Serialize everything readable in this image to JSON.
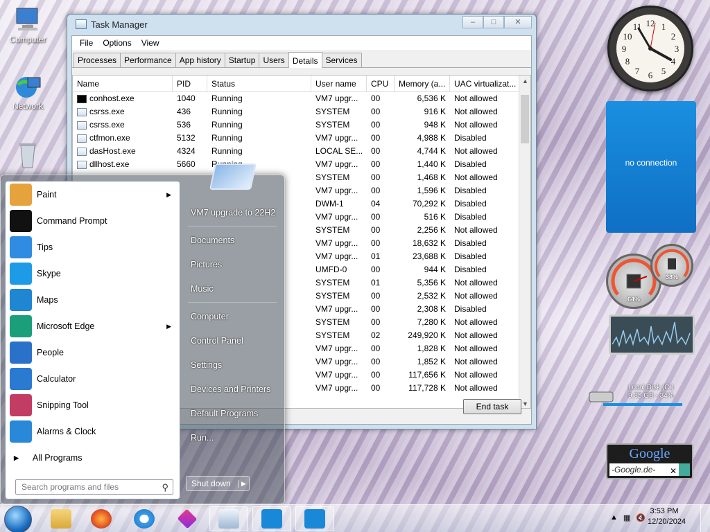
{
  "desktop": {
    "icons": [
      {
        "label": "Computer"
      },
      {
        "label": "Network"
      },
      {
        "label": ""
      }
    ]
  },
  "taskmgr": {
    "title": "Task Manager",
    "menu": [
      "File",
      "Options",
      "View"
    ],
    "tabs": [
      "Processes",
      "Performance",
      "App history",
      "Startup",
      "Users",
      "Details",
      "Services"
    ],
    "active_tab": "Details",
    "columns": [
      "Name",
      "PID",
      "Status",
      "User name",
      "CPU",
      "Memory (a...",
      "UAC virtualizat..."
    ],
    "rows": [
      {
        "name": "conhost.exe",
        "pid": "1040",
        "status": "Running",
        "user": "VM7 upgr...",
        "cpu": "00",
        "mem": "6,536 K",
        "uac": "Not allowed",
        "icon": "cmd"
      },
      {
        "name": "csrss.exe",
        "pid": "436",
        "status": "Running",
        "user": "SYSTEM",
        "cpu": "00",
        "mem": "916 K",
        "uac": "Not allowed",
        "icon": "app"
      },
      {
        "name": "csrss.exe",
        "pid": "536",
        "status": "Running",
        "user": "SYSTEM",
        "cpu": "00",
        "mem": "948 K",
        "uac": "Not allowed",
        "icon": "app"
      },
      {
        "name": "ctfmon.exe",
        "pid": "5132",
        "status": "Running",
        "user": "VM7 upgr...",
        "cpu": "00",
        "mem": "4,988 K",
        "uac": "Disabled",
        "icon": "app"
      },
      {
        "name": "dasHost.exe",
        "pid": "4324",
        "status": "Running",
        "user": "LOCAL SE...",
        "cpu": "00",
        "mem": "4,744 K",
        "uac": "Not allowed",
        "icon": "app"
      },
      {
        "name": "dllhost.exe",
        "pid": "5660",
        "status": "Running",
        "user": "VM7 upgr...",
        "cpu": "00",
        "mem": "1,440 K",
        "uac": "Disabled",
        "icon": "app"
      },
      {
        "name": "",
        "pid": "",
        "status": "",
        "user": "SYSTEM",
        "cpu": "00",
        "mem": "1,468 K",
        "uac": "Not allowed",
        "icon": ""
      },
      {
        "name": "",
        "pid": "",
        "status": "",
        "user": "VM7 upgr...",
        "cpu": "00",
        "mem": "1,596 K",
        "uac": "Disabled",
        "icon": ""
      },
      {
        "name": "",
        "pid": "",
        "status": "",
        "user": "DWM-1",
        "cpu": "04",
        "mem": "70,292 K",
        "uac": "Disabled",
        "icon": ""
      },
      {
        "name": "",
        "pid": "",
        "status": "",
        "user": "VM7 upgr...",
        "cpu": "00",
        "mem": "516 K",
        "uac": "Disabled",
        "icon": ""
      },
      {
        "name": "",
        "pid": "",
        "status": "",
        "user": "SYSTEM",
        "cpu": "00",
        "mem": "2,256 K",
        "uac": "Not allowed",
        "icon": ""
      },
      {
        "name": "",
        "pid": "",
        "status": "",
        "user": "VM7 upgr...",
        "cpu": "00",
        "mem": "18,632 K",
        "uac": "Disabled",
        "icon": ""
      },
      {
        "name": "",
        "pid": "",
        "status": "",
        "user": "VM7 upgr...",
        "cpu": "01",
        "mem": "23,688 K",
        "uac": "Disabled",
        "icon": ""
      },
      {
        "name": "",
        "pid": "",
        "status": "",
        "user": "UMFD-0",
        "cpu": "00",
        "mem": "944 K",
        "uac": "Disabled",
        "icon": ""
      },
      {
        "name": "",
        "pid": "",
        "status": "",
        "user": "SYSTEM",
        "cpu": "01",
        "mem": "5,356 K",
        "uac": "Not allowed",
        "icon": ""
      },
      {
        "name": "",
        "pid": "",
        "status": "",
        "user": "SYSTEM",
        "cpu": "00",
        "mem": "2,532 K",
        "uac": "Not allowed",
        "icon": ""
      },
      {
        "name": "",
        "pid": "",
        "status": "",
        "user": "VM7 upgr...",
        "cpu": "00",
        "mem": "2,308 K",
        "uac": "Disabled",
        "icon": ""
      },
      {
        "name": "",
        "pid": "",
        "status": "",
        "user": "SYSTEM",
        "cpu": "00",
        "mem": "7,280 K",
        "uac": "Not allowed",
        "icon": ""
      },
      {
        "name": "",
        "pid": "",
        "status": "",
        "user": "SYSTEM",
        "cpu": "02",
        "mem": "249,920 K",
        "uac": "Not allowed",
        "icon": ""
      },
      {
        "name": "",
        "pid": "",
        "status": "",
        "user": "VM7 upgr...",
        "cpu": "00",
        "mem": "1,828 K",
        "uac": "Not allowed",
        "icon": ""
      },
      {
        "name": "",
        "pid": "",
        "status": "",
        "user": "VM7 upgr...",
        "cpu": "00",
        "mem": "1,852 K",
        "uac": "Not allowed",
        "icon": ""
      },
      {
        "name": "",
        "pid": "",
        "status": "",
        "user": "VM7 upgr...",
        "cpu": "00",
        "mem": "117,656 K",
        "uac": "Not allowed",
        "icon": ""
      },
      {
        "name": "",
        "pid": "",
        "status": "",
        "user": "VM7 upgr...",
        "cpu": "00",
        "mem": "117,728 K",
        "uac": "Not allowed",
        "icon": ""
      }
    ],
    "end_task": "End task"
  },
  "start_menu": {
    "programs": [
      {
        "label": "Paint",
        "icon": "paint-icon",
        "color": "#e6a23c",
        "submenu": true
      },
      {
        "label": "Command Prompt",
        "icon": "command-prompt-icon",
        "color": "#111111",
        "submenu": false
      },
      {
        "label": "Tips",
        "icon": "tips-icon",
        "color": "#2f8ce0",
        "submenu": false
      },
      {
        "label": "Skype",
        "icon": "skype-icon",
        "color": "#1d9be6",
        "submenu": false
      },
      {
        "label": "Maps",
        "icon": "maps-icon",
        "color": "#1f86d1",
        "submenu": false
      },
      {
        "label": "Microsoft Edge",
        "icon": "edge-icon",
        "color": "#1a9f7a",
        "submenu": true
      },
      {
        "label": "People",
        "icon": "people-icon",
        "color": "#2a72c9",
        "submenu": false
      },
      {
        "label": "Calculator",
        "icon": "calculator-icon",
        "color": "#2a7ad1",
        "submenu": false
      },
      {
        "label": "Snipping Tool",
        "icon": "snipping-tool-icon",
        "color": "#c23c63",
        "submenu": false
      },
      {
        "label": "Alarms & Clock",
        "icon": "alarm-clock-icon",
        "color": "#2a88d8",
        "submenu": false
      }
    ],
    "all_programs": "All Programs",
    "search_placeholder": "Search programs and files",
    "right": [
      "VM7 upgrade to 22H2",
      "Documents",
      "Pictures",
      "Music",
      "Computer",
      "Control Panel",
      "Settings",
      "Devices and Printers",
      "Default Programs",
      "Run..."
    ],
    "shutdown": "Shut down"
  },
  "gadgets": {
    "weather": "no connection",
    "cpu_meter": "64%",
    "mem_meter": "38%",
    "drive": {
      "name": "Local Disk (C:)",
      "info": "9.35 GB - 34%"
    },
    "google": {
      "logo": "Google",
      "query": "-Google.de-"
    }
  },
  "taskbar": {
    "time": "3:53 PM",
    "date": "12/20/2024"
  },
  "colors": {
    "accent": "#1a8fe0",
    "taskbar": "#d0d8e4"
  }
}
